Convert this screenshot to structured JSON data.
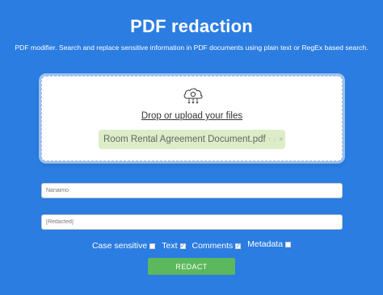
{
  "header": {
    "title": "PDF redaction",
    "subtitle": "PDF modifier. Search and replace sensitive information in PDF documents using plain text or RegEx based search."
  },
  "upload": {
    "label": "Drop or upload your files",
    "icon": "cloud-upload-icon",
    "file": {
      "name": "Room Rental Agreement Document.pdf",
      "actions": [
        "↑",
        "↓",
        "✕"
      ]
    }
  },
  "find_input": {
    "value": "Nanaimo"
  },
  "replace_input": {
    "value": "[Redacted]"
  },
  "options": [
    {
      "label": "Case sensitive",
      "checked": false
    },
    {
      "label": "Text",
      "checked": true
    },
    {
      "label": "Comments",
      "checked": true
    },
    {
      "label": "Metadata",
      "checked": false
    }
  ],
  "redact_button": {
    "label": "REDACT"
  },
  "colors": {
    "background": "#2b7de1",
    "button": "#5cb85c",
    "file_chip": "#dcedc8"
  }
}
